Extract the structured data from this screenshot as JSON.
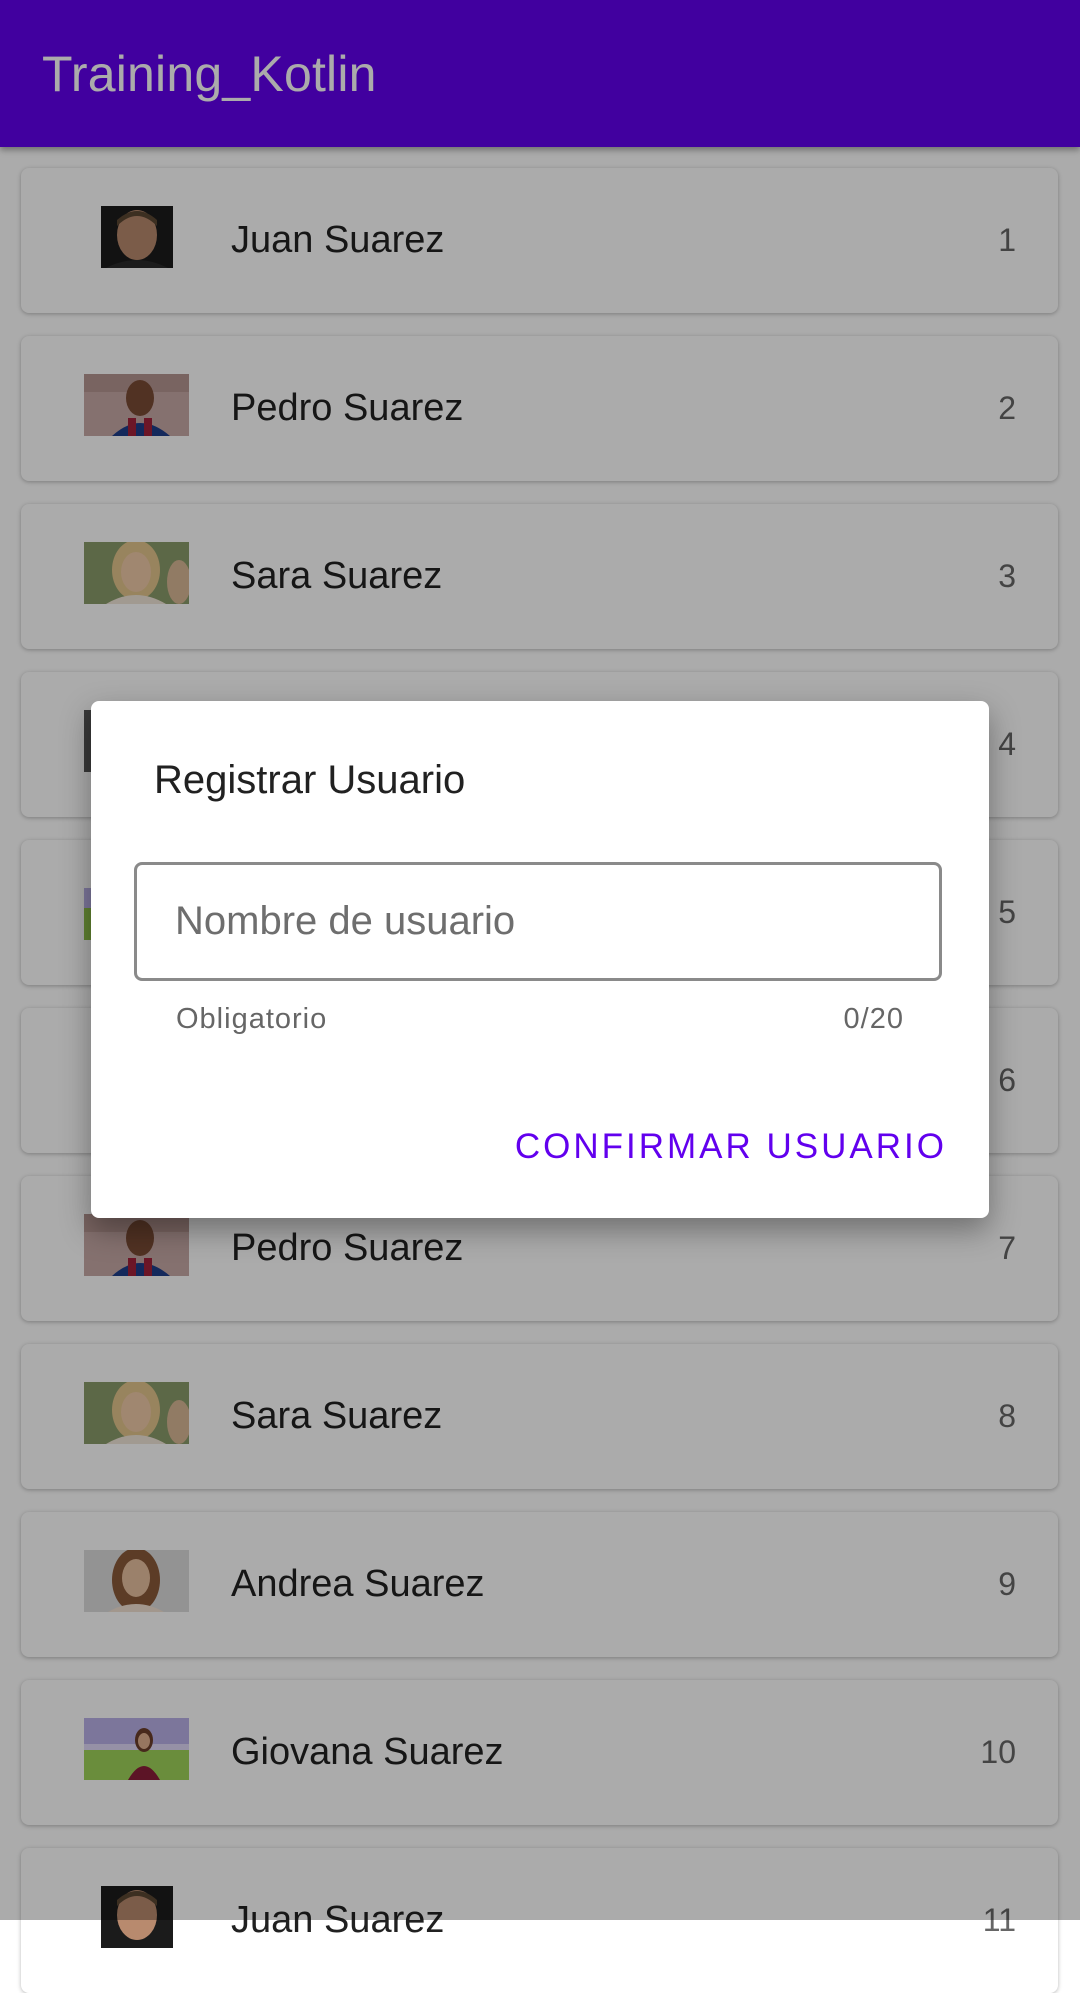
{
  "app_bar": {
    "title": "Training_Kotlin",
    "background": "#6200ee"
  },
  "list": {
    "items": [
      {
        "name": "Juan Suarez",
        "number": "1",
        "avatar": "man-portrait-icon"
      },
      {
        "name": "Pedro Suarez",
        "number": "2",
        "avatar": "footballer-portrait-icon"
      },
      {
        "name": "Sara Suarez",
        "number": "3",
        "avatar": "blonde-woman-portrait-icon"
      },
      {
        "name": "",
        "number": "4",
        "avatar": "man-portrait-icon"
      },
      {
        "name": "",
        "number": "5",
        "avatar": "stadium-woman-portrait-icon"
      },
      {
        "name": "",
        "number": "6",
        "avatar": "man-portrait-icon"
      },
      {
        "name": "Pedro Suarez",
        "number": "7",
        "avatar": "footballer-portrait-icon"
      },
      {
        "name": "Sara Suarez",
        "number": "8",
        "avatar": "blonde-woman-portrait-icon"
      },
      {
        "name": "Andrea Suarez",
        "number": "9",
        "avatar": "woman-portrait-icon"
      },
      {
        "name": "Giovana Suarez",
        "number": "10",
        "avatar": "stadium-woman-portrait-icon"
      },
      {
        "name": "Juan Suarez",
        "number": "11",
        "avatar": "man-portrait-icon"
      }
    ]
  },
  "dialog": {
    "title": "Registrar Usuario",
    "input_placeholder": "Nombre de usuario",
    "input_value": "",
    "helper_text": "Obligatorio",
    "counter": "0/20",
    "confirm_label": "CONFIRMAR USUARIO",
    "accent": "#6200ee"
  }
}
